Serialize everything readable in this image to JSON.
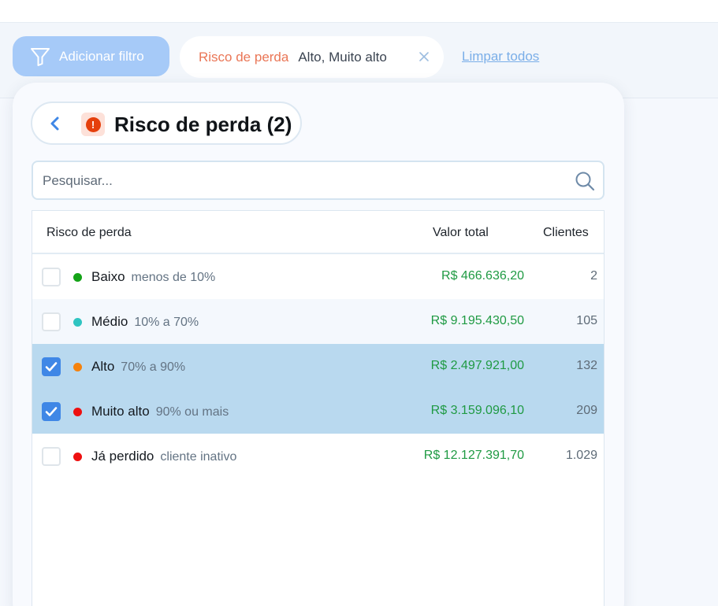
{
  "filters": {
    "add_filter_label": "Adicionar filtro",
    "active_chip": {
      "label": "Risco de perda",
      "value": "Alto, Muito alto"
    },
    "clear_all_label": "Limpar todos"
  },
  "panel": {
    "title": "Risco de perda (2)",
    "search_placeholder": "Pesquisar...",
    "columns": {
      "name": "Risco de perda",
      "value": "Valor total",
      "clients": "Clientes"
    },
    "rows": [
      {
        "name": "Baixo",
        "range": "menos de 10%",
        "value": "R$ 466.636,20",
        "clients": "2",
        "color": "#14a317",
        "checked": false
      },
      {
        "name": "Médio",
        "range": "10% a 70%",
        "value": "R$ 9.195.430,50",
        "clients": "105",
        "color": "#2fc4c1",
        "checked": false
      },
      {
        "name": "Alto",
        "range": "70% a 90%",
        "value": "R$ 2.497.921,00",
        "clients": "132",
        "color": "#f5820d",
        "checked": true
      },
      {
        "name": "Muito alto",
        "range": "90% ou mais",
        "value": "R$ 3.159.096,10",
        "clients": "209",
        "color": "#ee1010",
        "checked": true
      },
      {
        "name": "Já perdido",
        "range": "cliente inativo",
        "value": "R$ 12.127.391,70",
        "clients": "1.029",
        "color": "#ee1010",
        "checked": false
      }
    ]
  },
  "colors": {
    "accent": "#3f87e6",
    "selected_row": "#b9d9ef",
    "value_green": "#1f9a43",
    "chip_label": "#ea7656"
  },
  "icons": {
    "filter": "filter-icon",
    "close": "close-icon",
    "back": "chevron-left-icon",
    "risk": "alert-icon",
    "search": "search-icon",
    "check": "check-icon"
  }
}
